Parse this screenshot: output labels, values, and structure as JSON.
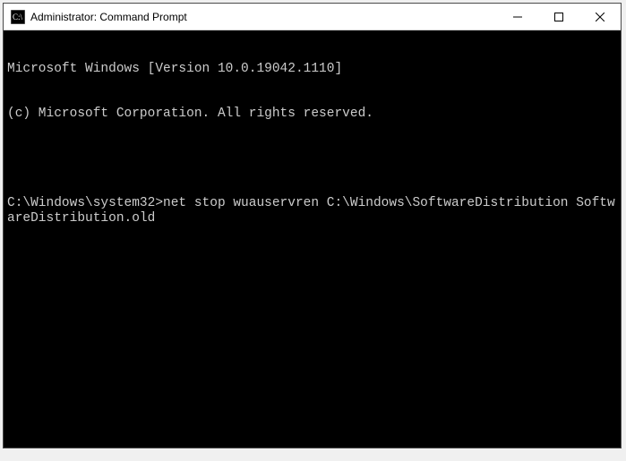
{
  "window": {
    "title": "Administrator: Command Prompt"
  },
  "terminal": {
    "line1": "Microsoft Windows [Version 10.0.19042.1110]",
    "line2": "(c) Microsoft Corporation. All rights reserved.",
    "prompt": "C:\\Windows\\system32>",
    "command": "net stop wuauservren C:\\Windows\\SoftwareDistribution SoftwareDistribution.old"
  }
}
